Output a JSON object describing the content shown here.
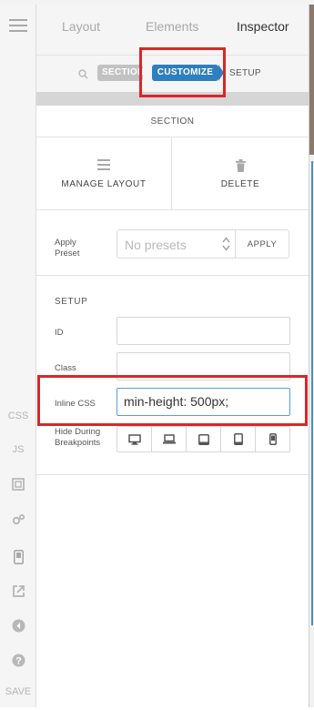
{
  "panel_tabs": [
    "Layout",
    "Elements",
    "Inspector"
  ],
  "active_tab": "Inspector",
  "breadcrumb": {
    "section": "SECTION",
    "customize": "CUSTOMIZE",
    "setup": "SETUP"
  },
  "section_header": "SECTION",
  "actions": {
    "manage_layout": "MANAGE LAYOUT",
    "delete": "DELETE"
  },
  "preset": {
    "label_line1": "Apply",
    "label_line2": "Preset",
    "placeholder": "No presets",
    "apply_button": "APPLY"
  },
  "setup": {
    "title": "SETUP",
    "id_label": "ID",
    "id_value": "",
    "class_label": "Class",
    "class_value": "",
    "inline_css_label": "Inline CSS",
    "inline_css_value": "min-height: 500px;",
    "hide_label_line1": "Hide During",
    "hide_label_line2": "Breakpoints"
  },
  "breakpoints": [
    "desktop",
    "laptop",
    "tablet-landscape",
    "tablet-portrait",
    "phone"
  ],
  "left_rail": {
    "css": "CSS",
    "js": "JS",
    "save": "SAVE"
  },
  "colors": {
    "accent": "#2e7fbf",
    "highlight": "#d9262b",
    "muted_chip": "#c2c2c2"
  }
}
